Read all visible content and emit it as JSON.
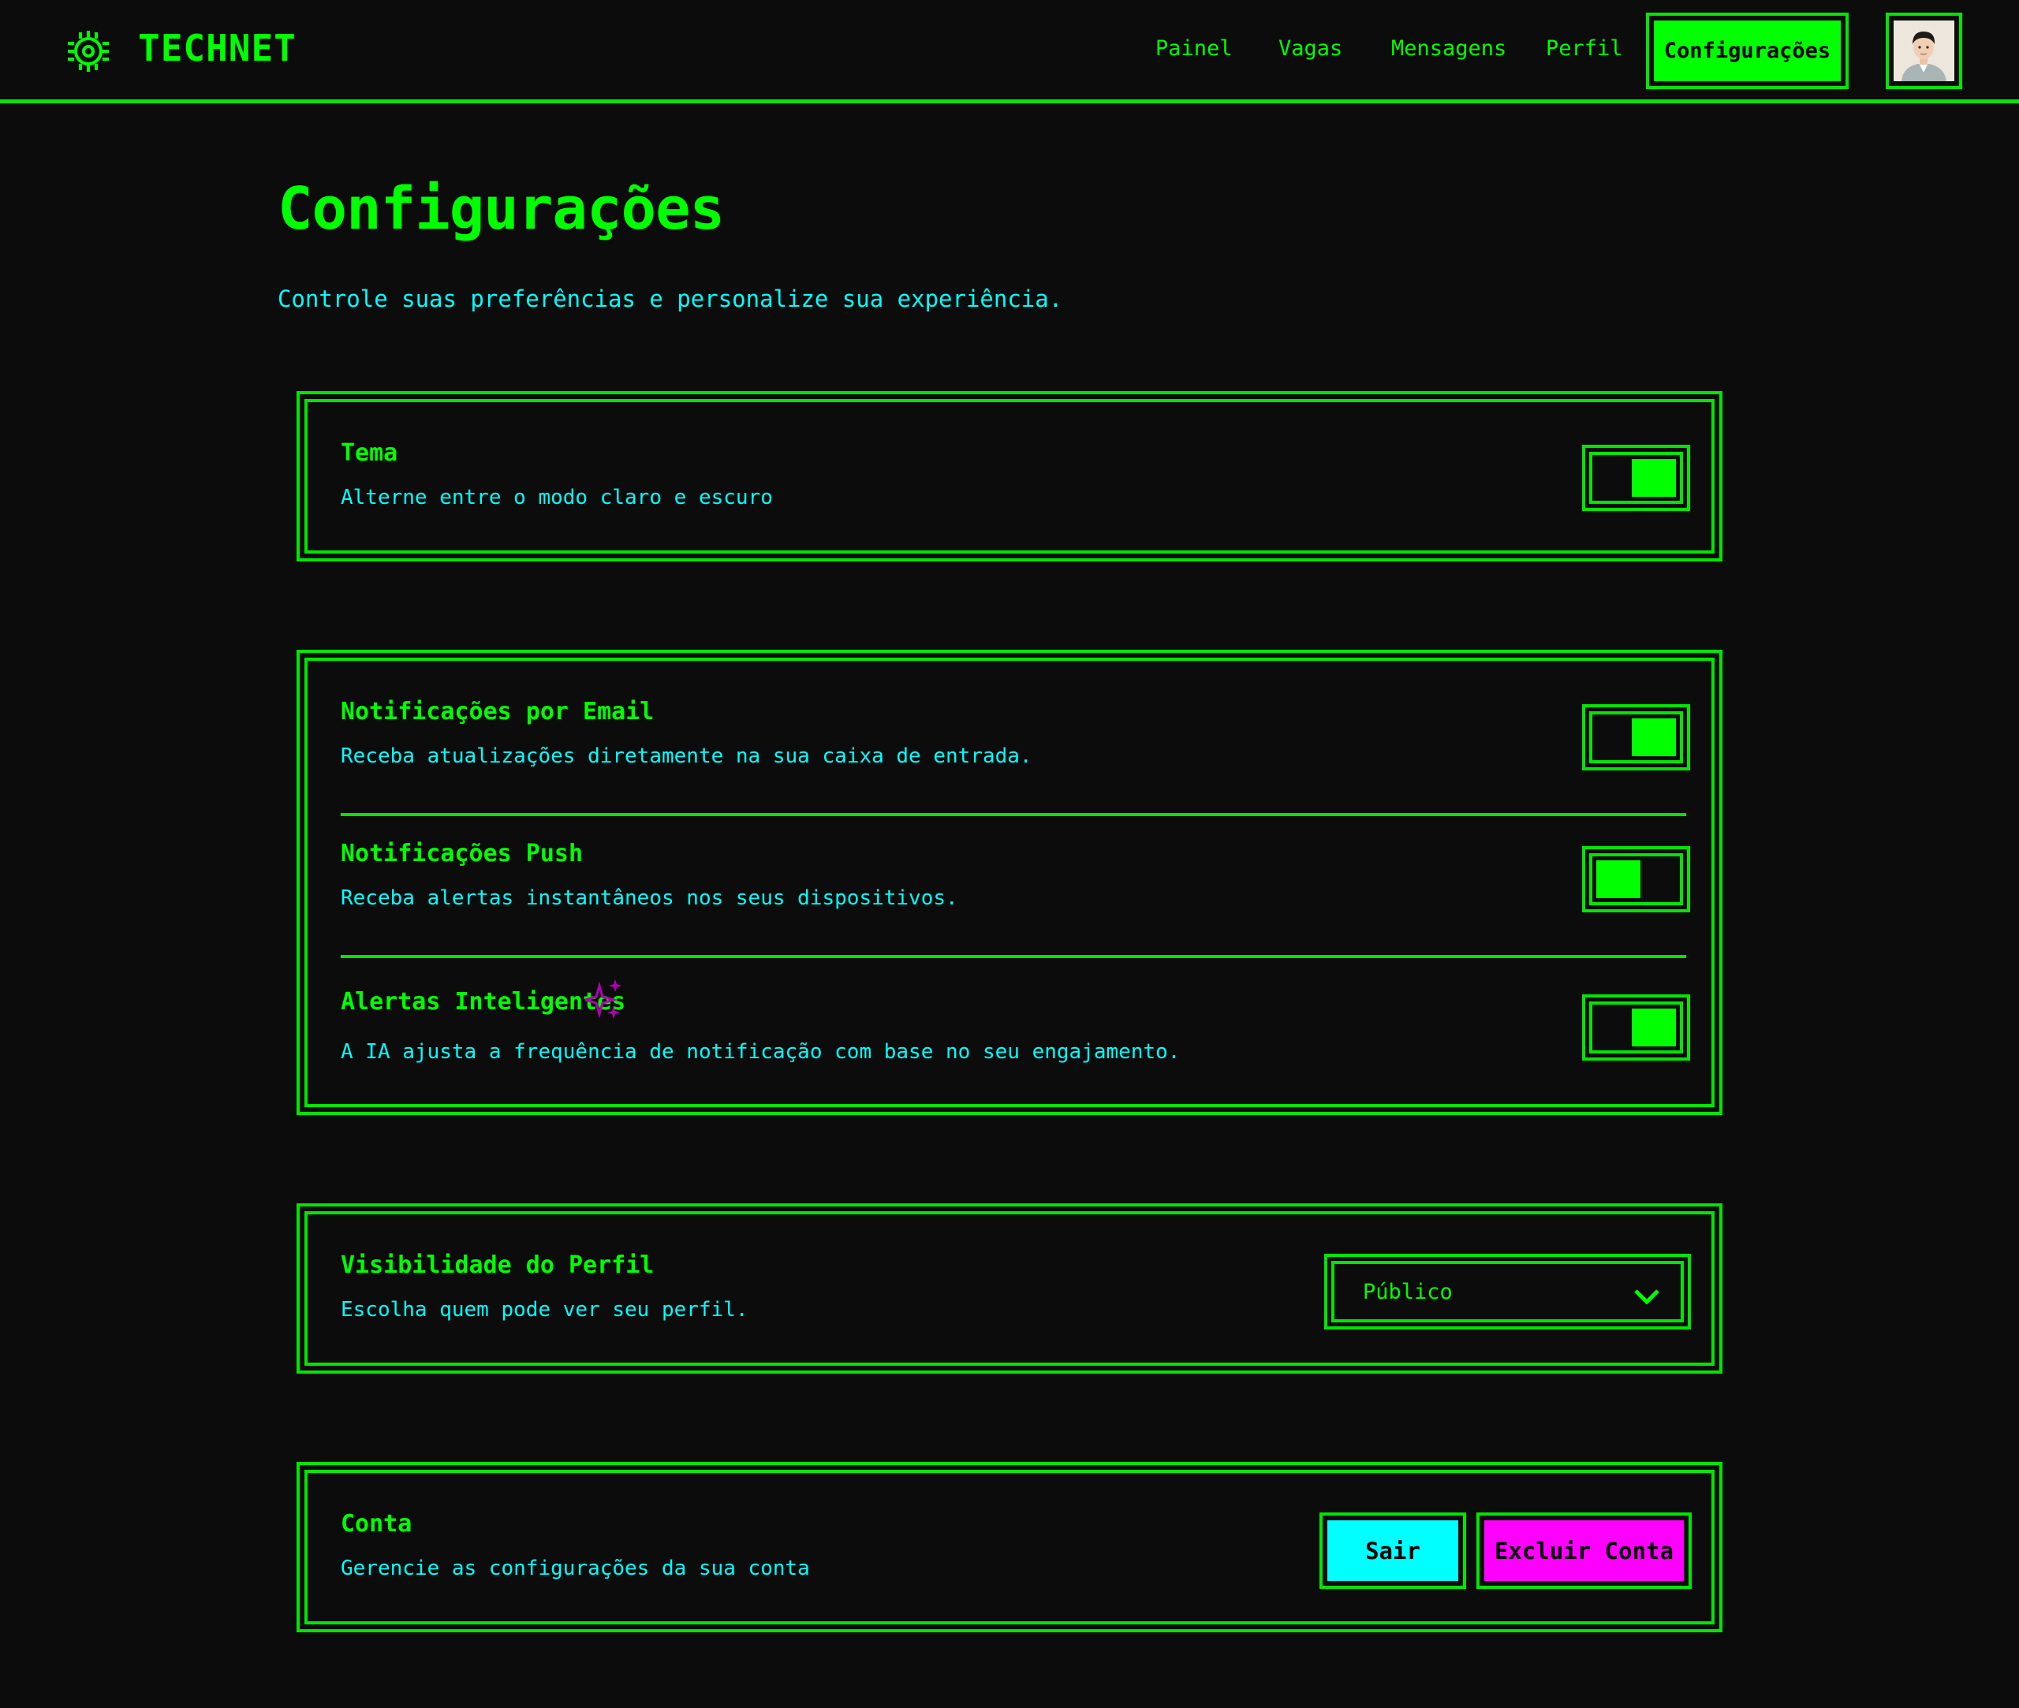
{
  "header": {
    "brand": "TECHNET",
    "nav": [
      "Painel",
      "Vagas",
      "Mensagens",
      "Perfil"
    ],
    "active_nav": "Configurações"
  },
  "page": {
    "title": "Configurações",
    "subtitle": "Controle suas preferências e personalize sua experiência."
  },
  "theme_card": {
    "title": "Tema",
    "desc": "Alterne entre o modo claro e escuro",
    "toggle_on": true
  },
  "notifications_card": {
    "rows": [
      {
        "title": "Notificações por Email",
        "desc": "Receba atualizações diretamente na sua caixa de entrada.",
        "toggle_on": true
      },
      {
        "title": "Notificações Push",
        "desc": "Receba alertas instantâneos nos seus dispositivos.",
        "toggle_on": false
      },
      {
        "title": "Alertas Inteligentes",
        "desc": "A IA ajusta a frequência de notificação com base no seu engajamento.",
        "toggle_on": true
      }
    ]
  },
  "visibility_card": {
    "title": "Visibilidade do Perfil",
    "desc": "Escolha quem pode ver seu perfil.",
    "selected": "Público"
  },
  "account_card": {
    "title": "Conta",
    "desc": "Gerencie as configurações da sua conta",
    "logout_label": "Sair",
    "delete_label": "Excluir Conta"
  },
  "colors": {
    "background": "#0c0c0c",
    "primary": "#00ff00",
    "text_secondary": "#00ffff",
    "logout_button": "#00ffff",
    "delete_button": "#ff00ff",
    "sparkle": "#b000b0"
  },
  "icons": {
    "logo": "chip-gear-icon",
    "sparkle": "sparkle-icon",
    "chevron": "chevron-down-icon"
  }
}
